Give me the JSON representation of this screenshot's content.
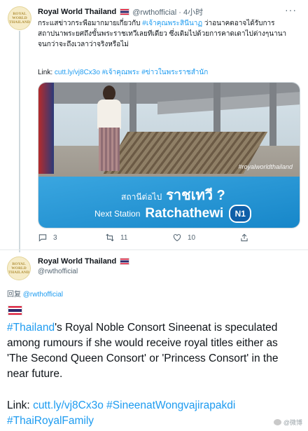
{
  "tweet1": {
    "author_name": "Royal World Thailand",
    "handle_time": "@rwthofficial · 4小时",
    "more_icon": "ellipsis-icon",
    "body_prefix": "กระแสข่าวกระพือมากมายเกี่ยวกับ ",
    "body_hashtag": "#เจ้าคุณพระสินีนาฏ",
    "body_suffix": " ว่าอนาคตอาจได้รับการสถาปนาพระยศถึงขั้นพระราชเทวีเลยทีเดียว ซึ่งเดิมไปด้วยการคาดเดาไปต่างๆนานา จนกว่าจะถึงเวลาว่าจริงหรือไม่",
    "link_label": "Link: ",
    "link_url": "cutt.ly/vj8Cx3o",
    "link_tags": " #เจ้าคุณพระ #ข่าวในพระราชสำนัก",
    "media": {
      "watermark": "#royalworldthailand",
      "sign_thai_small": "สถานีต่อไป",
      "sign_thai_big": "ราชเทวี ?",
      "sign_en_small": "Next Station",
      "sign_en_big": "Ratchathewi",
      "sign_code": "N1"
    },
    "actions": {
      "reply_count": "3",
      "retweet_count": "11",
      "like_count": "10"
    }
  },
  "tweet2": {
    "author_name": "Royal World Thailand",
    "handle": "@rwthofficial",
    "reply_label": "回复 ",
    "reply_handle": "@rwthofficial",
    "body_hashtag": "#Thailand",
    "body_text": "'s Royal Noble Consort Sineenat is speculated among rumours if she would receive royal titles either as 'The Second Queen Consort' or 'Princess Consort' in the near future.",
    "link_label": "Link: ",
    "link_url": "cutt.ly/vj8Cx3o",
    "link_tag1": " #SineenatWongvajirapakdi",
    "link_tag2": "#ThaiRoyalFamily"
  },
  "avatar_text": [
    "ROYAL",
    "WORLD",
    "THAILAND"
  ],
  "weibo_watermark": "@微博"
}
